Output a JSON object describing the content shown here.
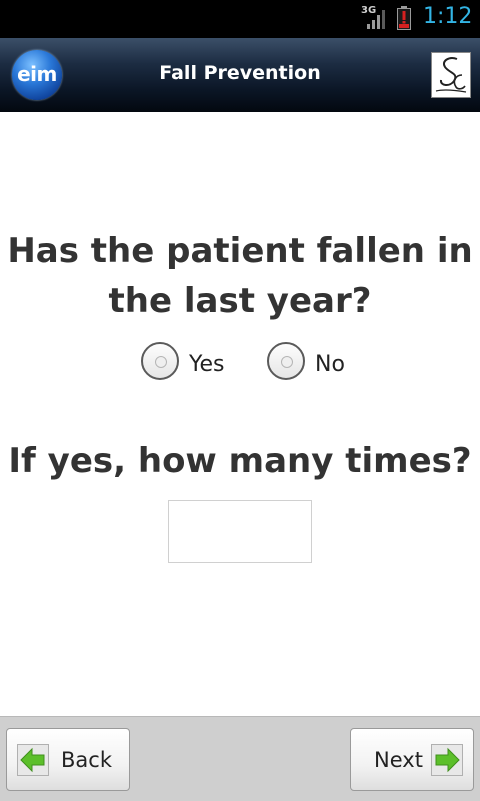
{
  "status_bar": {
    "network": "3G",
    "time": "1:12"
  },
  "app_bar": {
    "logo_text": "eim",
    "title": "Fall Prevention",
    "signature_icon": "signature-icon"
  },
  "form": {
    "question1": "Has the patient fallen in the last year?",
    "options": [
      {
        "label": "Yes",
        "selected": false
      },
      {
        "label": "No",
        "selected": false
      }
    ],
    "question2": "If yes, how many times?",
    "times_input": {
      "value": "",
      "placeholder": ""
    }
  },
  "footer": {
    "back_label": "Back",
    "next_label": "Next",
    "back_icon": "arrow-left-icon",
    "next_icon": "arrow-right-icon"
  },
  "colors": {
    "accent_time": "#33b5e5",
    "arrow_green": "#5cbf2a",
    "battery_red": "#d42020"
  }
}
